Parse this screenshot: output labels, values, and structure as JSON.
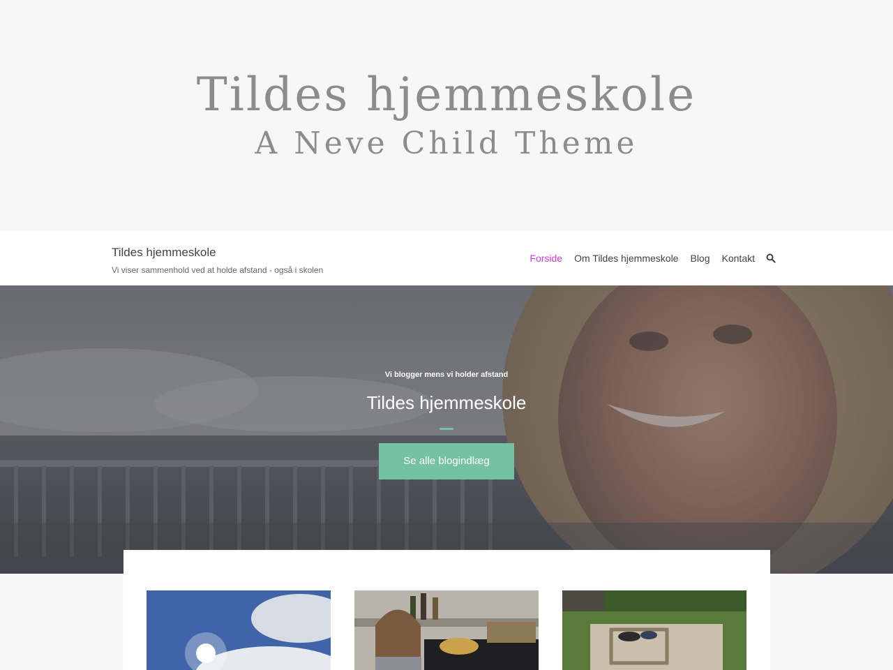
{
  "theme_banner": {
    "title": "Tildes hjemmeskole",
    "subtitle": "A Neve Child Theme"
  },
  "header": {
    "site_title": "Tildes hjemmeskole",
    "tagline": "Vi viser sammenhold ved at holde afstand - også i skolen",
    "nav": [
      {
        "label": "Forside",
        "active": true
      },
      {
        "label": "Om Tildes hjemmeskole",
        "active": false
      },
      {
        "label": "Blog",
        "active": false
      },
      {
        "label": "Kontakt",
        "active": false
      }
    ],
    "search_icon": "search-icon"
  },
  "hero": {
    "kicker": "Vi blogger mens vi holder afstand",
    "title": "Tildes hjemmeskole",
    "button_label": "Se alle blogindlæg"
  },
  "colors": {
    "accent": "#74c2a1",
    "nav_active": "#c43bd1",
    "text_dark": "#404248"
  }
}
